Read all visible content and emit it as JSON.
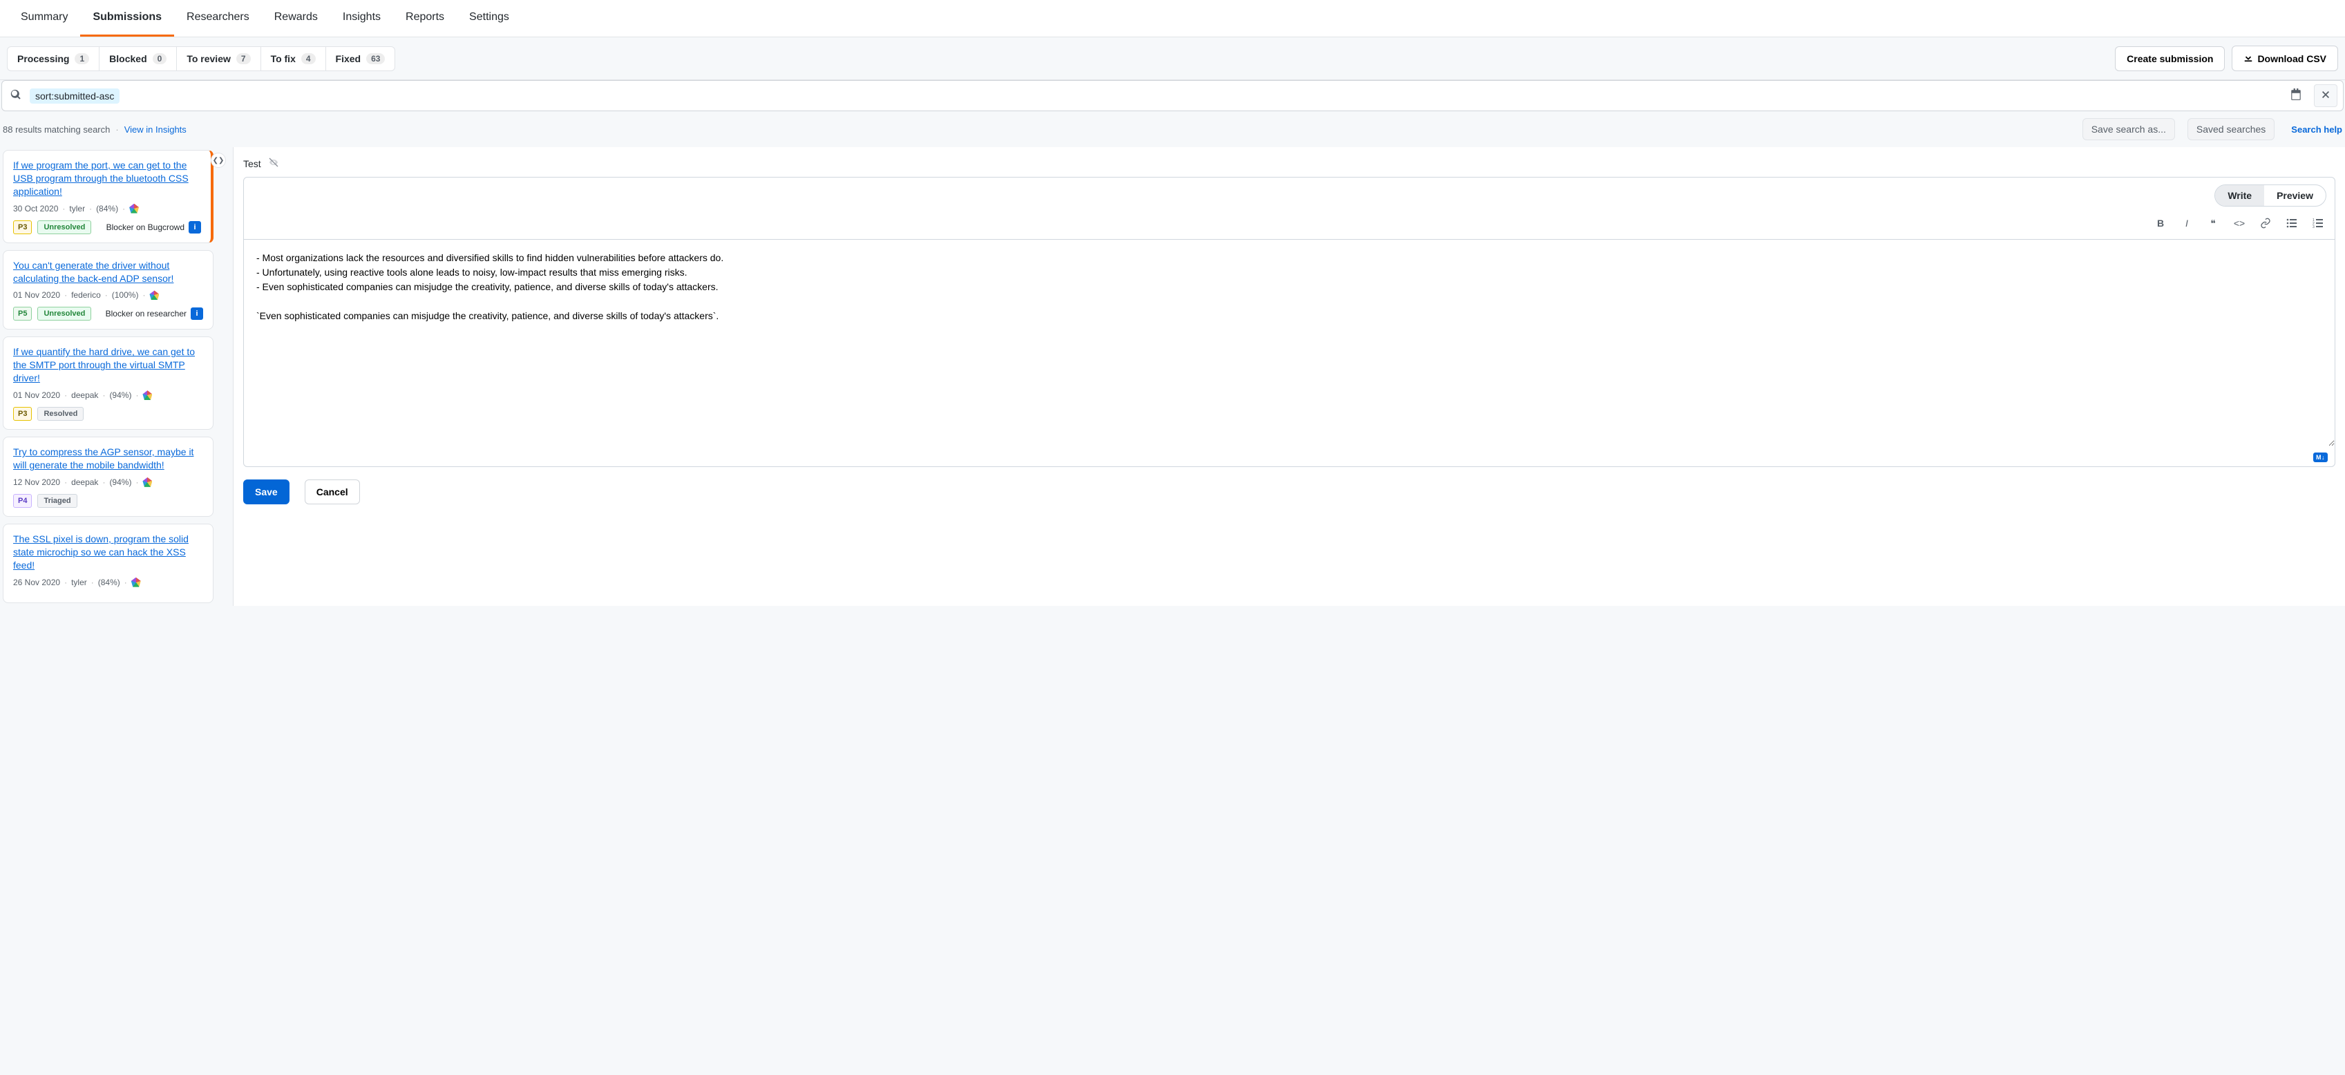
{
  "nav_tabs": [
    "Summary",
    "Submissions",
    "Researchers",
    "Rewards",
    "Insights",
    "Reports",
    "Settings"
  ],
  "active_nav": "Submissions",
  "filters": [
    {
      "label": "Processing",
      "count": 1
    },
    {
      "label": "Blocked",
      "count": 0
    },
    {
      "label": "To review",
      "count": 7
    },
    {
      "label": "To fix",
      "count": 4
    },
    {
      "label": "Fixed",
      "count": 63
    }
  ],
  "actions": {
    "create": "Create submission",
    "download": "Download CSV"
  },
  "search": {
    "token": "sort:submitted-asc",
    "placeholder": ""
  },
  "results_meta": {
    "count_text": "88 results matching search",
    "view_link": "View in Insights",
    "save_as": "Save search as...",
    "saved": "Saved searches",
    "help": "Search help"
  },
  "submissions": [
    {
      "title": "If we program the port, we can get to the USB program through the bluetooth CSS application!",
      "date": "30 Oct 2020",
      "author": "tyler",
      "percent": "(84%)",
      "priority": "P3",
      "priority_class": "p3",
      "status": "Unresolved",
      "status_class": "st-unresolved",
      "blocker": "Blocker on Bugcrowd",
      "selected": true
    },
    {
      "title": "You can't generate the driver without calculating the back-end ADP sensor!",
      "date": "01 Nov 2020",
      "author": "federico",
      "percent": "(100%)",
      "priority": "P5",
      "priority_class": "p5",
      "status": "Unresolved",
      "status_class": "st-unresolved",
      "blocker": "Blocker on researcher",
      "selected": false
    },
    {
      "title": "If we quantify the hard drive, we can get to the SMTP port through the virtual SMTP driver!",
      "date": "01 Nov 2020",
      "author": "deepak",
      "percent": "(94%)",
      "priority": "P3",
      "priority_class": "p3",
      "status": "Resolved",
      "status_class": "st-resolved",
      "blocker": "",
      "selected": false
    },
    {
      "title": "Try to compress the AGP sensor, maybe it will generate the mobile bandwidth!",
      "date": "12 Nov 2020",
      "author": "deepak",
      "percent": "(94%)",
      "priority": "P4",
      "priority_class": "p4",
      "status": "Triaged",
      "status_class": "st-triaged",
      "blocker": "",
      "selected": false
    },
    {
      "title": "The SSL pixel is down, program the solid state microchip so we can hack the XSS feed!",
      "date": "26 Nov 2020",
      "author": "tyler",
      "percent": "(84%)",
      "priority": "",
      "priority_class": "",
      "status": "",
      "status_class": "",
      "blocker": "",
      "selected": false
    }
  ],
  "detail": {
    "title": "Test",
    "write_tab": "Write",
    "preview_tab": "Preview",
    "body": "- Most organizations lack the resources and diversified skills to find hidden vulnerabilities before attackers do.\n- Unfortunately, using reactive tools alone leads to noisy, low-impact results that miss emerging risks.\n- Even sophisticated companies can misjudge the creativity, patience, and diverse skills of today's attackers.\n\n`Even sophisticated companies can misjudge the creativity, patience, and diverse skills of today's attackers`.",
    "save": "Save",
    "cancel": "Cancel",
    "markdown_badge": "M↓"
  }
}
